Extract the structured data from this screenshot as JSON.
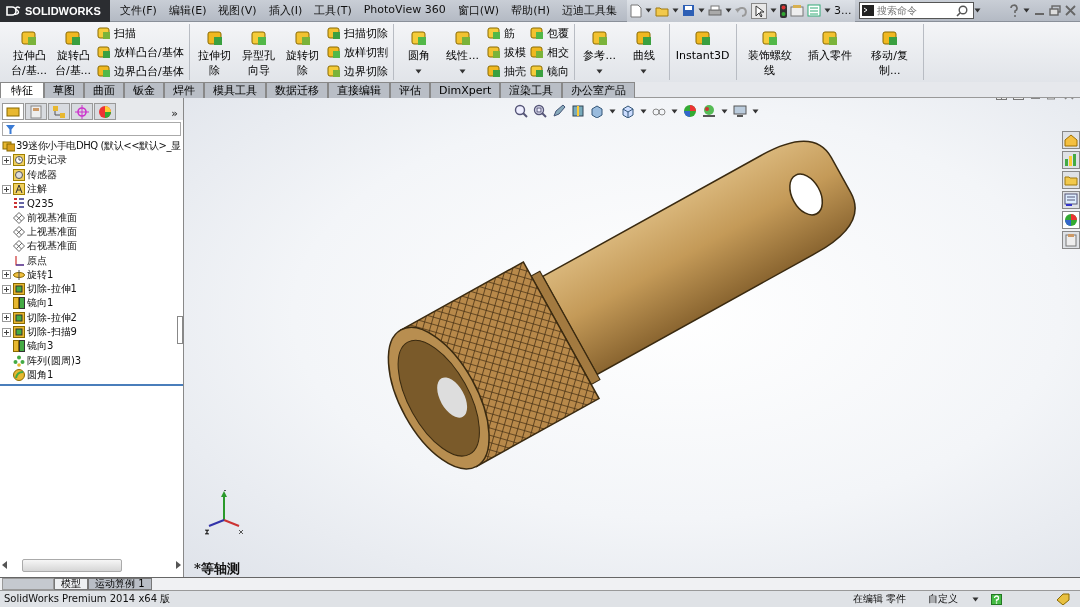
{
  "app": {
    "logo": "SOLIDWORKS"
  },
  "menu": [
    {
      "label": "文件(F)"
    },
    {
      "label": "编辑(E)"
    },
    {
      "label": "视图(V)"
    },
    {
      "label": "插入(I)"
    },
    {
      "label": "工具(T)"
    },
    {
      "label": "PhotoView 360"
    },
    {
      "label": "窗口(W)"
    },
    {
      "label": "帮助(H)"
    },
    {
      "label": "迈迪工具集"
    }
  ],
  "quick_toolbar": {
    "overflow": "3..."
  },
  "search": {
    "placeholder": "搜索命令"
  },
  "ribbon": [
    {
      "items": [
        {
          "kind": "large",
          "label": "拉伸凸台/基...",
          "dropdown": false
        },
        {
          "kind": "large",
          "label": "旋转凸台/基...",
          "dropdown": false
        },
        {
          "kind": "stack",
          "items": [
            {
              "label": "扫描"
            },
            {
              "label": "放样凸台/基体"
            },
            {
              "label": "边界凸台/基体"
            }
          ]
        }
      ]
    },
    {
      "items": [
        {
          "kind": "large",
          "label": "拉伸切除",
          "dropdown": false
        },
        {
          "kind": "large",
          "label": "异型孔向导",
          "dropdown": false
        },
        {
          "kind": "large",
          "label": "旋转切除",
          "dropdown": false
        },
        {
          "kind": "stack",
          "items": [
            {
              "label": "扫描切除"
            },
            {
              "label": "放样切割"
            },
            {
              "label": "边界切除"
            }
          ]
        }
      ]
    },
    {
      "items": [
        {
          "kind": "large",
          "label": "圆角",
          "dropdown": true
        },
        {
          "kind": "large",
          "label": "线性...",
          "dropdown": true
        },
        {
          "kind": "stack",
          "items": [
            {
              "label": "筋"
            },
            {
              "label": "拔模"
            },
            {
              "label": "抽壳"
            }
          ]
        },
        {
          "kind": "stack",
          "items": [
            {
              "label": "包覆"
            },
            {
              "label": "相交"
            },
            {
              "label": "镜向"
            }
          ]
        }
      ]
    },
    {
      "items": [
        {
          "kind": "large",
          "label": "参考...",
          "dropdown": true
        },
        {
          "kind": "large",
          "label": "曲线",
          "dropdown": true
        }
      ]
    },
    {
      "items": [
        {
          "kind": "large",
          "label": "Instant3D",
          "dropdown": false
        }
      ]
    },
    {
      "items": [
        {
          "kind": "large",
          "label": "装饰螺纹线",
          "dropdown": false
        },
        {
          "kind": "large",
          "label": "插入零件",
          "dropdown": false
        },
        {
          "kind": "large",
          "label": "移动/复制...",
          "dropdown": false
        }
      ]
    }
  ],
  "command_tabs": [
    {
      "label": "特征",
      "selected": true
    },
    {
      "label": "草图",
      "selected": false
    },
    {
      "label": "曲面",
      "selected": false
    },
    {
      "label": "钣金",
      "selected": false
    },
    {
      "label": "焊件",
      "selected": false
    },
    {
      "label": "模具工具",
      "selected": false
    },
    {
      "label": "数据迁移",
      "selected": false
    },
    {
      "label": "直接编辑",
      "selected": false
    },
    {
      "label": "评估",
      "selected": false
    },
    {
      "label": "DimXpert",
      "selected": false
    },
    {
      "label": "渲染工具",
      "selected": false
    },
    {
      "label": "办公室产品",
      "selected": false
    }
  ],
  "panel_tabs": {
    "tabs": [
      {
        "selected": true
      },
      {
        "selected": false
      },
      {
        "selected": false
      },
      {
        "selected": false
      },
      {
        "selected": false
      }
    ],
    "overflow": "»"
  },
  "task_pane": [
    {
      "selected": false
    },
    {
      "selected": false
    },
    {
      "selected": false
    },
    {
      "selected": false
    },
    {
      "selected": true
    },
    {
      "selected": false
    }
  ],
  "feature_tree": {
    "root": {
      "label": "39迷你小手电DHQ  (默认<<默认>_显",
      "children": [
        {
          "label": "历史记录",
          "kind": "history",
          "collapsed": true
        },
        {
          "label": "传感器",
          "kind": "sensor",
          "collapsed": false
        },
        {
          "label": "注解",
          "kind": "annotation",
          "collapsed": true
        },
        {
          "label": "Q235",
          "kind": "material",
          "collapsed": false
        },
        {
          "label": "前视基准面",
          "kind": "plane",
          "collapsed": false
        },
        {
          "label": "上视基准面",
          "kind": "plane",
          "collapsed": false
        },
        {
          "label": "右视基准面",
          "kind": "plane",
          "collapsed": false
        },
        {
          "label": "原点",
          "kind": "origin",
          "collapsed": false
        },
        {
          "label": "旋转1",
          "kind": "revolve",
          "collapsed": true
        },
        {
          "label": "切除-拉伸1",
          "kind": "cut",
          "collapsed": true
        },
        {
          "label": "镜向1",
          "kind": "mirror",
          "collapsed": false
        },
        {
          "label": "切除-拉伸2",
          "kind": "cut",
          "collapsed": true
        },
        {
          "label": "切除-扫描9",
          "kind": "cut",
          "collapsed": true
        },
        {
          "label": "镜向3",
          "kind": "mirror",
          "collapsed": false
        },
        {
          "label": "阵列(圆周)3",
          "kind": "pattern",
          "collapsed": false
        },
        {
          "label": "圆角1",
          "kind": "fillet",
          "collapsed": false
        }
      ]
    }
  },
  "viewport": {
    "view_name": "*等轴测"
  },
  "bottom_tabs": [
    {
      "label": "模型",
      "selected": true
    },
    {
      "label": "运动算例 1",
      "selected": false
    }
  ],
  "status_bar": {
    "product": "SolidWorks Premium 2014 x64 版",
    "mode": "在编辑 零件",
    "units": "自定义"
  }
}
